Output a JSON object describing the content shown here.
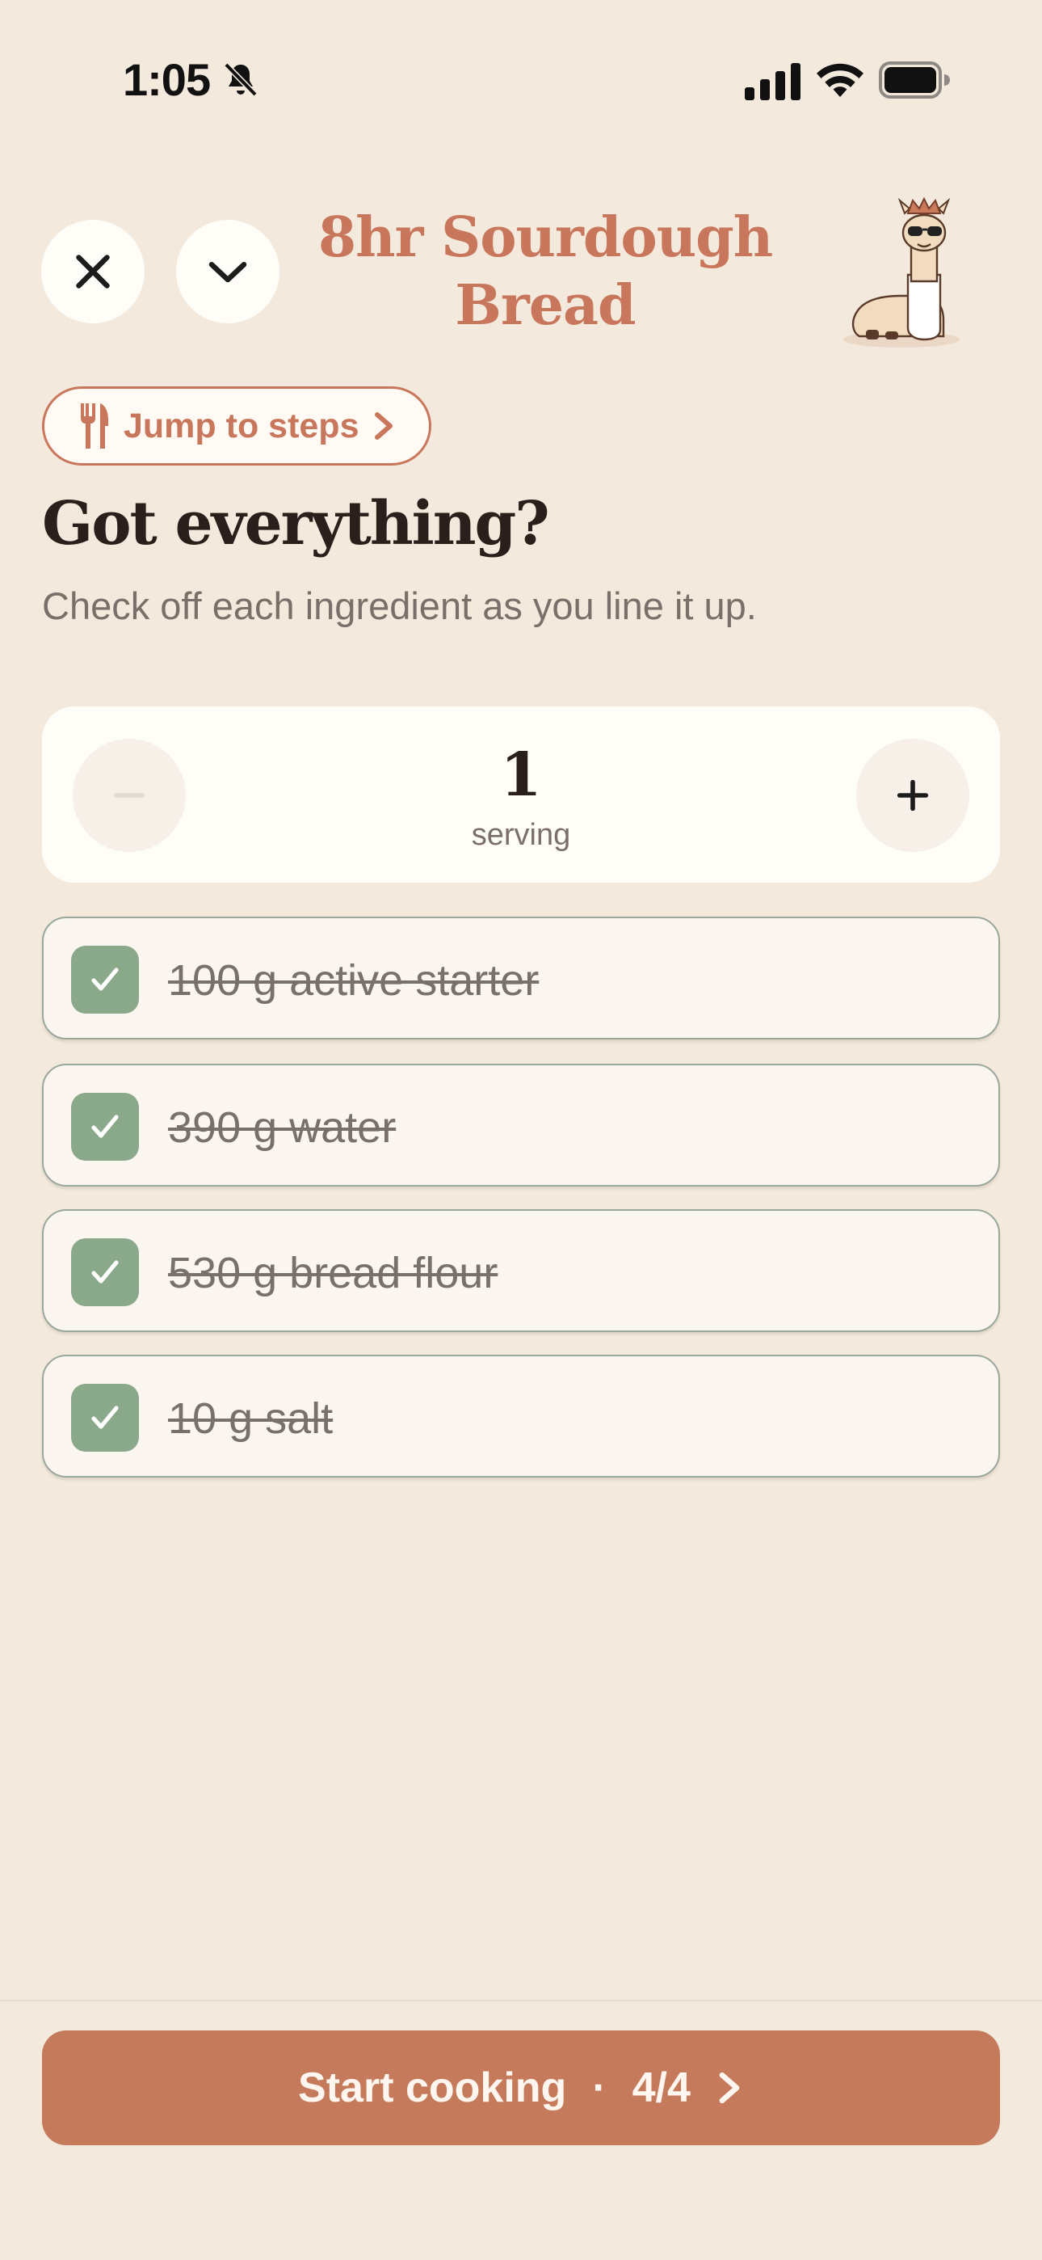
{
  "status_bar": {
    "time": "1:05",
    "icons": [
      "bell-slash-icon",
      "cellular-signal-icon",
      "wifi-icon",
      "battery-icon"
    ]
  },
  "header": {
    "close_icon": "close-icon",
    "collapse_icon": "chevron-down-icon",
    "title": "8hr Sourdough Bread",
    "mascot": "llama-mascot-icon"
  },
  "jump": {
    "icon": "fork-knife-icon",
    "label": "Jump to steps",
    "chevron": "chevron-right-icon"
  },
  "intro": {
    "title": "Got everything?",
    "subtitle": "Check off each ingredient as you line it up."
  },
  "servings": {
    "count": "1",
    "label": "serving",
    "minus_icon": "minus-icon",
    "plus_icon": "plus-icon"
  },
  "ingredients": [
    {
      "label": "100 g active starter",
      "checked": true
    },
    {
      "label": "390 g water",
      "checked": true
    },
    {
      "label": "530 g bread flour",
      "checked": true
    },
    {
      "label": "10 g salt",
      "checked": true
    }
  ],
  "cta": {
    "label": "Start cooking",
    "separator": "·",
    "progress": "4/4",
    "chevron": "chevron-right-icon"
  },
  "colors": {
    "background": "#f3eadd",
    "accent": "#c67a5c",
    "title": "#c9775c",
    "check": "#8aa98a",
    "card": "#fffdf8"
  }
}
